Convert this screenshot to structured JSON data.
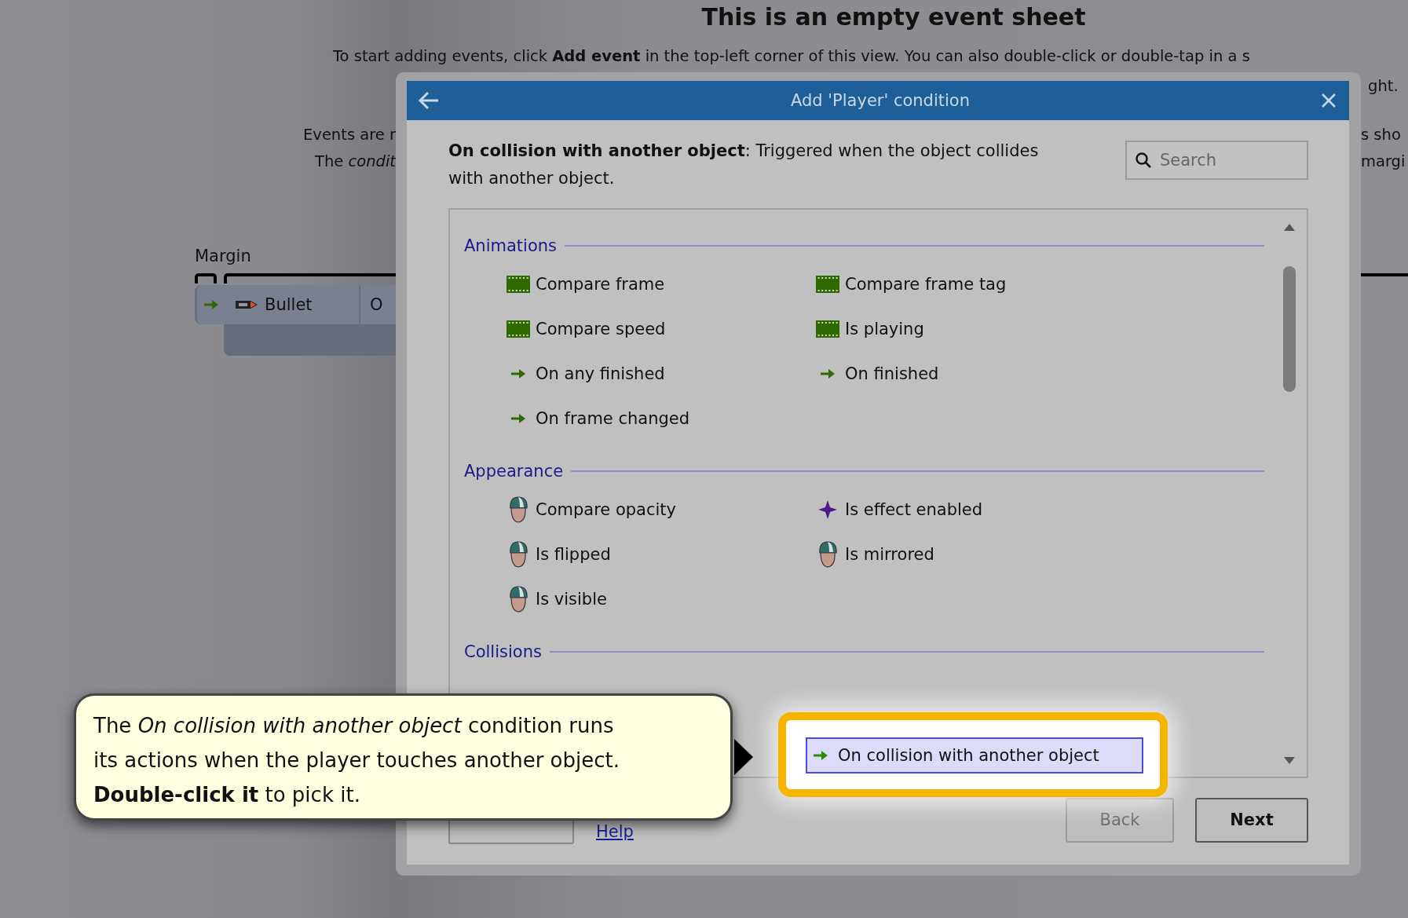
{
  "sheet": {
    "title": "This is an empty event sheet",
    "intro": "To start adding events, click **Add event** in the top-left corner of this view. You can also double-click or double-tap in a s",
    "fragments": [
      "ght.",
      "Events are r",
      "s sho",
      "The *condit*",
      "margi"
    ]
  },
  "event_row": {
    "margin_label": "Margin",
    "object": "Bullet",
    "column_2": "O"
  },
  "dialog": {
    "title": "Add 'Player' condition",
    "description": "**On collision with another object**: Triggered when the object collides with another object.",
    "search": {
      "placeholder": "Search"
    },
    "sections": [
      {
        "title": "Animations",
        "highlighted": false,
        "items": [
          {
            "label": "Compare frame",
            "kind": "animation",
            "selected": false
          },
          {
            "label": "Compare frame tag",
            "kind": "animation",
            "selected": false
          },
          {
            "label": "Compare speed",
            "kind": "animation",
            "selected": false
          },
          {
            "label": "Is playing",
            "kind": "animation",
            "selected": false
          },
          {
            "label": "On any finished",
            "kind": "trigger",
            "selected": false
          },
          {
            "label": "On finished",
            "kind": "trigger",
            "selected": false
          },
          {
            "label": "On frame changed",
            "kind": "trigger",
            "selected": false
          }
        ]
      },
      {
        "title": "Appearance",
        "highlighted": false,
        "items": [
          {
            "label": "Compare opacity",
            "kind": "sprite",
            "selected": false
          },
          {
            "label": "Is effect enabled",
            "kind": "effect",
            "selected": false
          },
          {
            "label": "Is flipped",
            "kind": "sprite",
            "selected": false
          },
          {
            "label": "Is mirrored",
            "kind": "sprite",
            "selected": false
          },
          {
            "label": "Is visible",
            "kind": "sprite",
            "selected": false
          }
        ]
      },
      {
        "title": "Collisions",
        "highlighted": true,
        "items": [
          {
            "label": "On collision with another object",
            "kind": "trigger",
            "selected": true
          }
        ]
      }
    ],
    "footer": {
      "help_link": "Help",
      "back": {
        "label": "Back",
        "disabled": true
      },
      "next": {
        "label": "Next",
        "disabled": false
      }
    }
  },
  "tooltip": {
    "text": "The *On collision with another object* condition runs its actions when the player touches another object. **Double-click it** to pick it."
  }
}
